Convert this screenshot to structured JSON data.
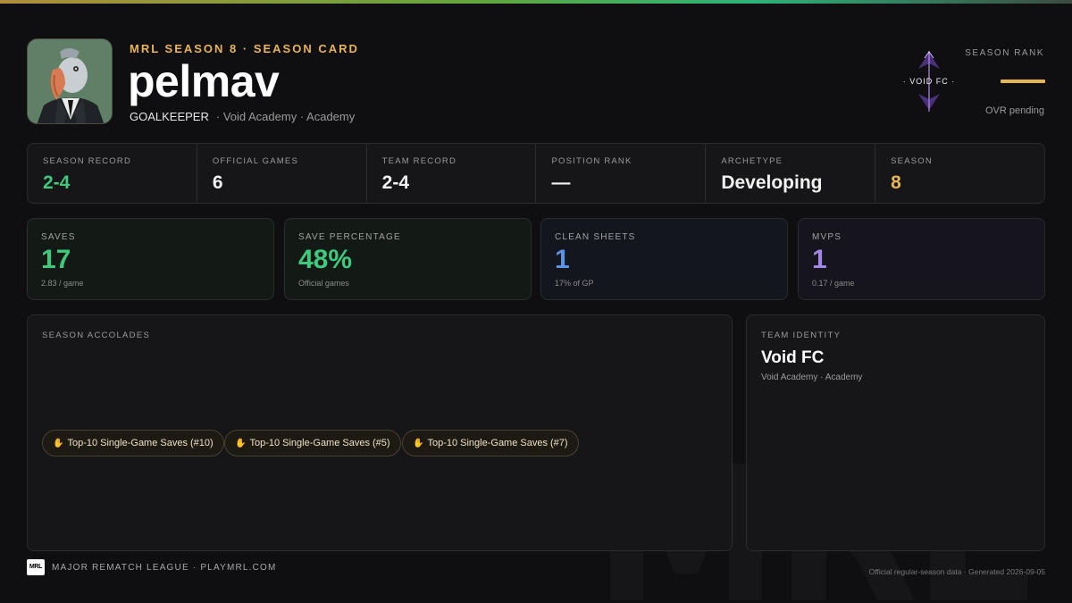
{
  "header": {
    "eyebrow": "MRL SEASON 8 · SEASON CARD",
    "player_name": "pelmav",
    "position": "GOALKEEPER",
    "team_line": "· Void Academy · Academy",
    "team_logo_text": "· VOID FC ·",
    "rank_label": "SEASON RANK",
    "ovr_note": "OVR pending"
  },
  "info": [
    {
      "label": "SEASON RECORD",
      "value": "2-4",
      "color": "#3ec97d"
    },
    {
      "label": "OFFICIAL GAMES",
      "value": "6",
      "color": "#f2f2f2"
    },
    {
      "label": "TEAM RECORD",
      "value": "2-4",
      "color": "#f2f2f2"
    },
    {
      "label": "POSITION RANK",
      "value": "—",
      "color": "#f2f2f2"
    },
    {
      "label": "ARCHETYPE",
      "value": "Developing",
      "color": "#f2f2f2"
    },
    {
      "label": "SEASON",
      "value": "8",
      "color": "#e8b454"
    }
  ],
  "stats": [
    {
      "label": "SAVES",
      "value": "17",
      "sub": "2.83 / game",
      "color": "#3ec97d",
      "bg": "#131a16"
    },
    {
      "label": "SAVE PERCENTAGE",
      "value": "48%",
      "sub": "Official games",
      "color": "#3ec97d",
      "bg": "#131a16"
    },
    {
      "label": "CLEAN SHEETS",
      "value": "1",
      "sub": "17% of GP",
      "color": "#5b93e6",
      "bg": "#13161d"
    },
    {
      "label": "MVPS",
      "value": "1",
      "sub": "0.17 / game",
      "color": "#a287e6",
      "bg": "#16141c"
    }
  ],
  "accolades": {
    "label": "SEASON ACCOLADES",
    "items": [
      "Top-10 Single-Game Saves (#10)",
      "Top-10 Single-Game Saves (#5)",
      "Top-10 Single-Game Saves (#7)"
    ],
    "icon": "glove-icon"
  },
  "team_identity": {
    "label": "TEAM IDENTITY",
    "name": "Void FC",
    "sub": "Void Academy · Academy"
  },
  "footer": {
    "logo_text": "MRL",
    "league": "MAJOR REMATCH LEAGUE · PLAYMRL.COM",
    "note": "Official regular-season data · Generated 2026-09-05"
  },
  "watermark": "MRL",
  "colors": {
    "accent_gold": "#e8b454",
    "accent_green": "#3ec97d",
    "accent_blue": "#5b93e6",
    "accent_purple": "#a287e6",
    "background": "#0f0f11"
  }
}
